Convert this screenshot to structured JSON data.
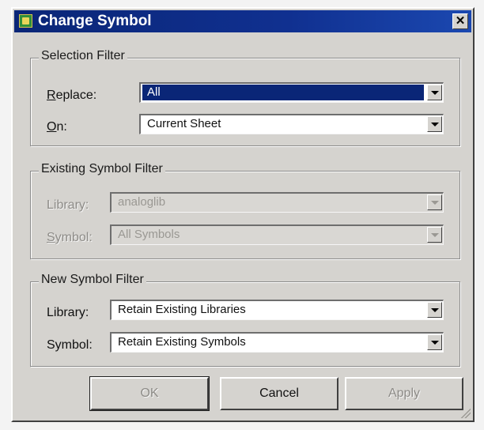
{
  "window": {
    "title": "Change Symbol",
    "icon": "app-icon",
    "close_glyph": "✕"
  },
  "selection_filter": {
    "legend": "Selection Filter",
    "replace_label_mnemonic": "R",
    "replace_label_rest": "eplace:",
    "replace_value": "All",
    "on_label_mnemonic": "O",
    "on_label_rest": "n:",
    "on_value": "Current Sheet"
  },
  "existing_filter": {
    "legend": "Existing Symbol Filter",
    "library_label": "Library:",
    "library_value": "analoglib",
    "symbol_label_mnemonic": "S",
    "symbol_label_rest": "ymbol:",
    "symbol_value": "All Symbols"
  },
  "new_filter": {
    "legend": "New Symbol Filter",
    "library_label": "Library:",
    "library_value": "Retain Existing Libraries",
    "symbol_label": "Symbol:",
    "symbol_value": "Retain Existing Symbols"
  },
  "buttons": {
    "ok": "OK",
    "cancel": "Cancel",
    "apply": "Apply"
  },
  "colors": {
    "title_bar": "#0a2677",
    "dialog_face": "#d5d3cf",
    "selected_highlight": "#0a2677"
  }
}
